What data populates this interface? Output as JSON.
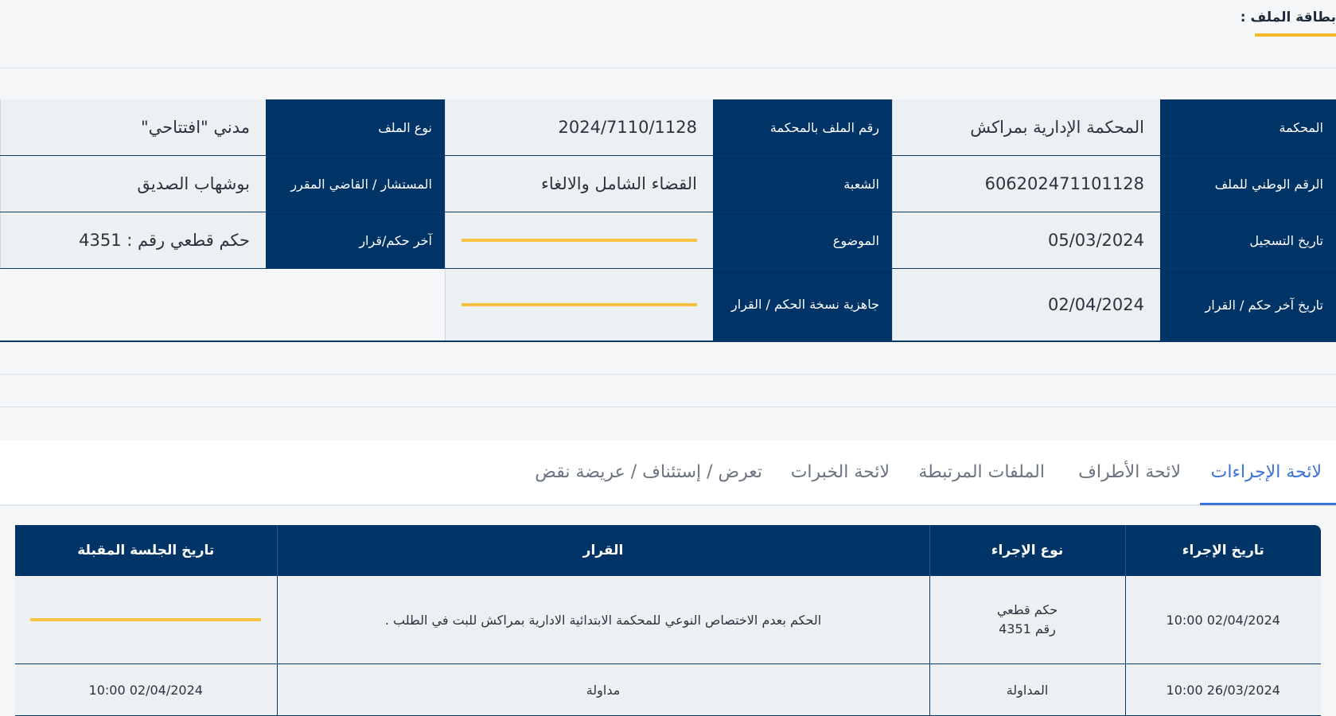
{
  "header": {
    "title": "بطاقة الملف :"
  },
  "info": {
    "row1": {
      "court_label": "المحكمة",
      "court_value": "المحكمة الإدارية بمراكش",
      "file_no_label": "رقم الملف بالمحكمة",
      "file_no_value": "2024/7110/1128",
      "file_type_label": "نوع الملف",
      "file_type_value": "مدني \"افتتاحي\""
    },
    "row2": {
      "national_label": "الرقم الوطني للملف",
      "national_value": "606202471101128",
      "division_label": "الشعبة",
      "division_value": "القضاء الشامل والالغاء",
      "judge_label": "المستشار / القاضي المقرر",
      "judge_value": "بوشهاب الصديق"
    },
    "row3": {
      "reg_date_label": "تاريخ التسجيل",
      "reg_date_value": "05/03/2024",
      "subject_label": "الموضوع",
      "last_ruling_label": "آخر حكم/قرار",
      "last_ruling_value": "حكم قطعي رقم : 4351"
    },
    "row4": {
      "last_ruling_date_label": "تاريخ آخر حكم / القرار",
      "last_ruling_date_value": "02/04/2024",
      "copy_ready_label": "جاهزية نسخة الحكم / القرار"
    }
  },
  "tabs": [
    {
      "label": "لائحة الإجراءات",
      "active": true
    },
    {
      "label": "لائحة الأطراف",
      "active": false
    },
    {
      "label": "الملفات المرتبطة",
      "active": false
    },
    {
      "label": "لائحة الخبرات",
      "active": false
    },
    {
      "label": "تعرض / إستئناف / عريضة نقض",
      "active": false
    }
  ],
  "procedures": {
    "headers": [
      "تاريخ الإجراء",
      "نوع الإجراء",
      "القرار",
      "تاريخ الجلسة المقبلة"
    ],
    "rows": [
      {
        "date": "02/04/2024 10:00",
        "type_line1": "حكم قطعي",
        "type_line2": "رقم 4351",
        "decision": "الحكم بعدم الاختصاص النوعي للمحكمة الابتدائية الادارية بمراكش للبت في الطلب .",
        "next_session": ""
      },
      {
        "date": "26/03/2024 10:00",
        "type_line1": "المداولة",
        "decision": "مداولة",
        "next_session": "02/04/2024 10:00"
      }
    ]
  },
  "colors": {
    "navy": "#003366",
    "accent_yellow": "#f5c242",
    "active_tab": "#3b73d6"
  }
}
